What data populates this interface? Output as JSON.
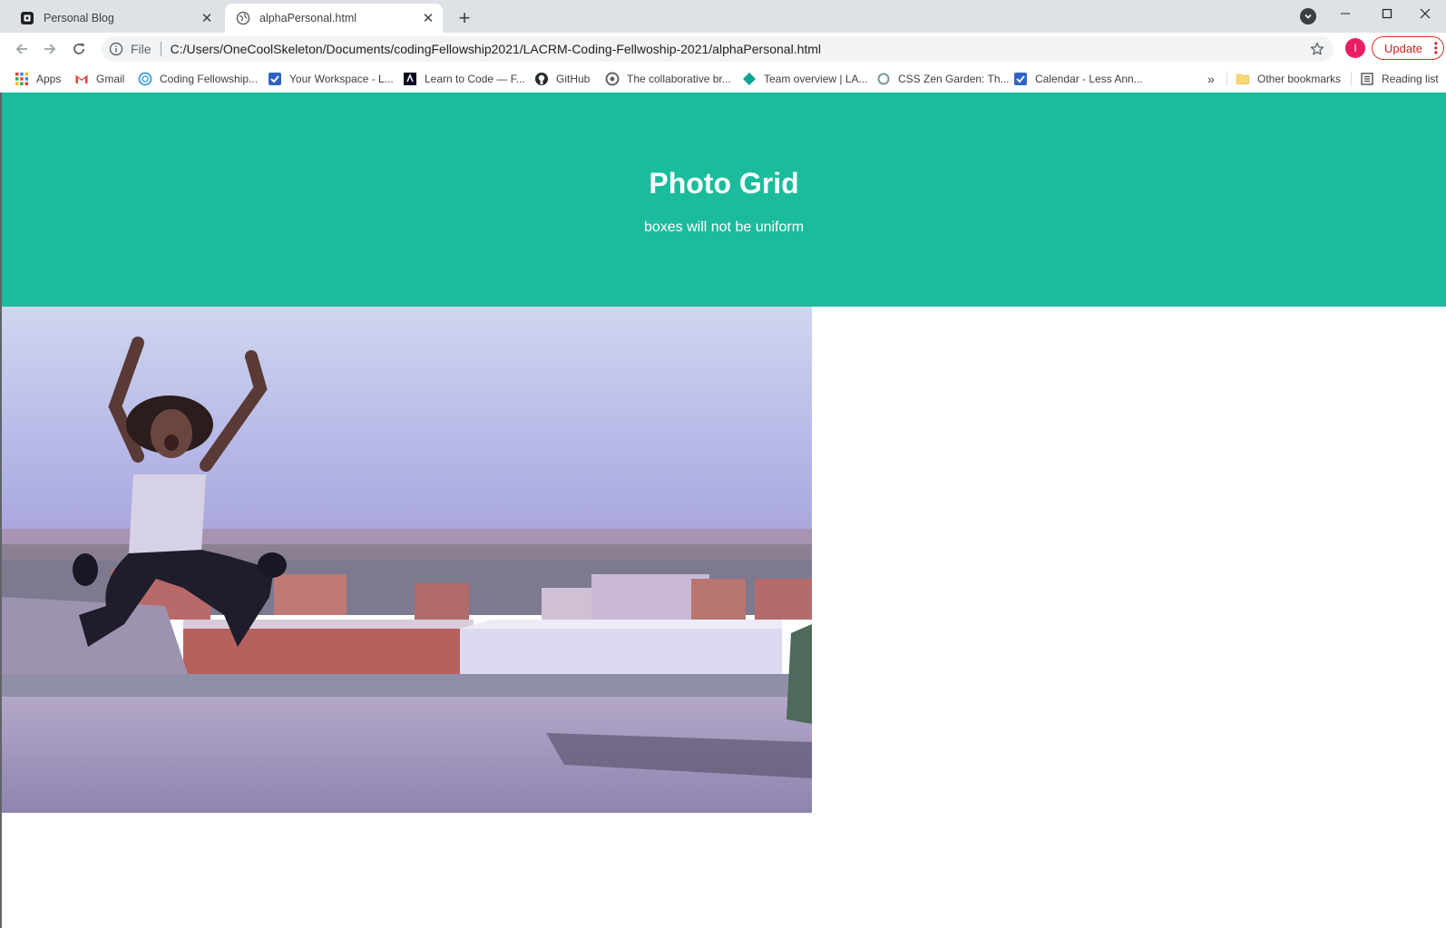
{
  "browser": {
    "tabs": [
      {
        "title": "Personal Blog",
        "active": false
      },
      {
        "title": "alphaPersonal.html",
        "active": true
      }
    ],
    "address": {
      "scheme_label": "File",
      "url": "C:/Users/OneCoolSkeleton/Documents/codingFellowship2021/LACRM-Coding-Fellwoship-2021/alphaPersonal.html"
    },
    "profile_initial": "I",
    "update_label": "Update",
    "bookmarks": [
      {
        "label": "Apps",
        "icon": "apps-grid-icon"
      },
      {
        "label": "Gmail",
        "icon": "gmail-icon"
      },
      {
        "label": "Coding Fellowship...",
        "icon": "swirl-icon"
      },
      {
        "label": "Your Workspace - L...",
        "icon": "checkbox-icon"
      },
      {
        "label": "Learn to Code — F...",
        "icon": "code-logo-icon"
      },
      {
        "label": "GitHub",
        "icon": "github-icon"
      },
      {
        "label": "The collaborative br...",
        "icon": "circle-logo-icon"
      },
      {
        "label": "Team overview | LA...",
        "icon": "diamond-icon"
      },
      {
        "label": "CSS Zen Garden: Th...",
        "icon": "ring-icon"
      },
      {
        "label": "Calendar - Less Ann...",
        "icon": "checkbox-icon"
      }
    ],
    "overflow_label": "»",
    "other_bookmarks": "Other bookmarks",
    "reading_list": "Reading list"
  },
  "page": {
    "title": "Photo Grid",
    "subtitle": "boxes will not be uniform",
    "hero_color": "#1abc9c"
  }
}
